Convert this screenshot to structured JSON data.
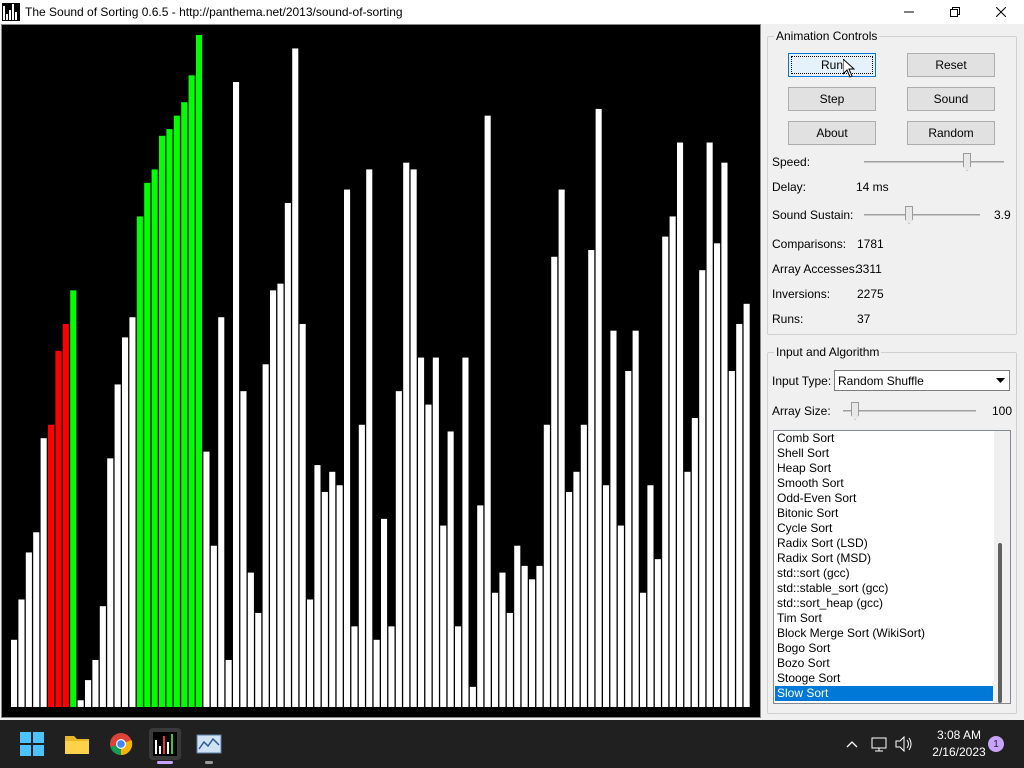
{
  "window": {
    "title": "The Sound of Sorting 0.6.5 - http://panthema.net/2013/sound-of-sorting"
  },
  "visualization": {
    "background": "#000000",
    "colors": {
      "normal": "#ffffff",
      "compared": "#ff0000",
      "sorted": "#00ff00"
    },
    "bars": [
      {
        "v": 10,
        "c": "w"
      },
      {
        "v": 16,
        "c": "w"
      },
      {
        "v": 23,
        "c": "w"
      },
      {
        "v": 26,
        "c": "w"
      },
      {
        "v": 40,
        "c": "w"
      },
      {
        "v": 42,
        "c": "r"
      },
      {
        "v": 53,
        "c": "r"
      },
      {
        "v": 57,
        "c": "r"
      },
      {
        "v": 62,
        "c": "g"
      },
      {
        "v": 1,
        "c": "w"
      },
      {
        "v": 4,
        "c": "w"
      },
      {
        "v": 7,
        "c": "w"
      },
      {
        "v": 15,
        "c": "w"
      },
      {
        "v": 37,
        "c": "w"
      },
      {
        "v": 48,
        "c": "w"
      },
      {
        "v": 55,
        "c": "w"
      },
      {
        "v": 58,
        "c": "w"
      },
      {
        "v": 73,
        "c": "g"
      },
      {
        "v": 78,
        "c": "g"
      },
      {
        "v": 80,
        "c": "g"
      },
      {
        "v": 85,
        "c": "g"
      },
      {
        "v": 86,
        "c": "g"
      },
      {
        "v": 88,
        "c": "g"
      },
      {
        "v": 90,
        "c": "g"
      },
      {
        "v": 94,
        "c": "g"
      },
      {
        "v": 100,
        "c": "g"
      },
      {
        "v": 38,
        "c": "w"
      },
      {
        "v": 24,
        "c": "w"
      },
      {
        "v": 58,
        "c": "w"
      },
      {
        "v": 7,
        "c": "w"
      },
      {
        "v": 93,
        "c": "w"
      },
      {
        "v": 47,
        "c": "w"
      },
      {
        "v": 20,
        "c": "w"
      },
      {
        "v": 14,
        "c": "w"
      },
      {
        "v": 51,
        "c": "w"
      },
      {
        "v": 62,
        "c": "w"
      },
      {
        "v": 63,
        "c": "w"
      },
      {
        "v": 75,
        "c": "w"
      },
      {
        "v": 98,
        "c": "w"
      },
      {
        "v": 57,
        "c": "w"
      },
      {
        "v": 16,
        "c": "w"
      },
      {
        "v": 36,
        "c": "w"
      },
      {
        "v": 32,
        "c": "w"
      },
      {
        "v": 35,
        "c": "w"
      },
      {
        "v": 33,
        "c": "w"
      },
      {
        "v": 77,
        "c": "w"
      },
      {
        "v": 12,
        "c": "w"
      },
      {
        "v": 42,
        "c": "w"
      },
      {
        "v": 80,
        "c": "w"
      },
      {
        "v": 10,
        "c": "w"
      },
      {
        "v": 28,
        "c": "w"
      },
      {
        "v": 12,
        "c": "w"
      },
      {
        "v": 47,
        "c": "w"
      },
      {
        "v": 81,
        "c": "w"
      },
      {
        "v": 80,
        "c": "w"
      },
      {
        "v": 52,
        "c": "w"
      },
      {
        "v": 45,
        "c": "w"
      },
      {
        "v": 52,
        "c": "w"
      },
      {
        "v": 27,
        "c": "w"
      },
      {
        "v": 41,
        "c": "w"
      },
      {
        "v": 12,
        "c": "w"
      },
      {
        "v": 52,
        "c": "w"
      },
      {
        "v": 3,
        "c": "w"
      },
      {
        "v": 30,
        "c": "w"
      },
      {
        "v": 88,
        "c": "w"
      },
      {
        "v": 17,
        "c": "w"
      },
      {
        "v": 20,
        "c": "w"
      },
      {
        "v": 14,
        "c": "w"
      },
      {
        "v": 24,
        "c": "w"
      },
      {
        "v": 21,
        "c": "w"
      },
      {
        "v": 19,
        "c": "w"
      },
      {
        "v": 21,
        "c": "w"
      },
      {
        "v": 42,
        "c": "w"
      },
      {
        "v": 67,
        "c": "w"
      },
      {
        "v": 77,
        "c": "w"
      },
      {
        "v": 32,
        "c": "w"
      },
      {
        "v": 35,
        "c": "w"
      },
      {
        "v": 42,
        "c": "w"
      },
      {
        "v": 68,
        "c": "w"
      },
      {
        "v": 89,
        "c": "w"
      },
      {
        "v": 33,
        "c": "w"
      },
      {
        "v": 56,
        "c": "w"
      },
      {
        "v": 27,
        "c": "w"
      },
      {
        "v": 50,
        "c": "w"
      },
      {
        "v": 56,
        "c": "w"
      },
      {
        "v": 17,
        "c": "w"
      },
      {
        "v": 33,
        "c": "w"
      },
      {
        "v": 22,
        "c": "w"
      },
      {
        "v": 70,
        "c": "w"
      },
      {
        "v": 73,
        "c": "w"
      },
      {
        "v": 84,
        "c": "w"
      },
      {
        "v": 35,
        "c": "w"
      },
      {
        "v": 43,
        "c": "w"
      },
      {
        "v": 65,
        "c": "w"
      },
      {
        "v": 84,
        "c": "w"
      },
      {
        "v": 69,
        "c": "w"
      },
      {
        "v": 81,
        "c": "w"
      },
      {
        "v": 50,
        "c": "w"
      },
      {
        "v": 57,
        "c": "w"
      },
      {
        "v": 60,
        "c": "w"
      }
    ]
  },
  "animation_controls": {
    "title": "Animation Controls",
    "buttons": {
      "run": "Run",
      "reset": "Reset",
      "step": "Step",
      "sound": "Sound",
      "about": "About",
      "random": "Random"
    },
    "speed_label": "Speed:",
    "speed_level": 0.75,
    "delay_label": "Delay:",
    "delay_value": "14 ms",
    "sustain_label": "Sound Sustain:",
    "sustain_level": 0.38,
    "sustain_value": "3.9",
    "stats": {
      "comparisons_label": "Comparisons:",
      "comparisons": "1781",
      "accesses_label": "Array Accesses:",
      "accesses": "3311",
      "inversions_label": "Inversions:",
      "inversions": "2275",
      "runs_label": "Runs:",
      "runs": "37"
    }
  },
  "input_algorithm": {
    "title": "Input and Algorithm",
    "input_type_label": "Input Type:",
    "input_type_value": "Random Shuffle",
    "array_size_label": "Array Size:",
    "array_size_level": 0.06,
    "array_size_value": "100",
    "algorithms": [
      "Comb Sort",
      "Shell Sort",
      "Heap Sort",
      "Smooth Sort",
      "Odd-Even Sort",
      "Bitonic Sort",
      "Cycle Sort",
      "Radix Sort (LSD)",
      "Radix Sort (MSD)",
      "std::sort (gcc)",
      "std::stable_sort (gcc)",
      "std::sort_heap (gcc)",
      "Tim Sort",
      "Block Merge Sort (WikiSort)",
      "Bogo Sort",
      "Bozo Sort",
      "Stooge Sort",
      "Slow Sort"
    ],
    "selected_algorithm": "Slow Sort"
  },
  "taskbar": {
    "time": "3:08 AM",
    "date": "2/16/2023",
    "notifications": "1"
  }
}
